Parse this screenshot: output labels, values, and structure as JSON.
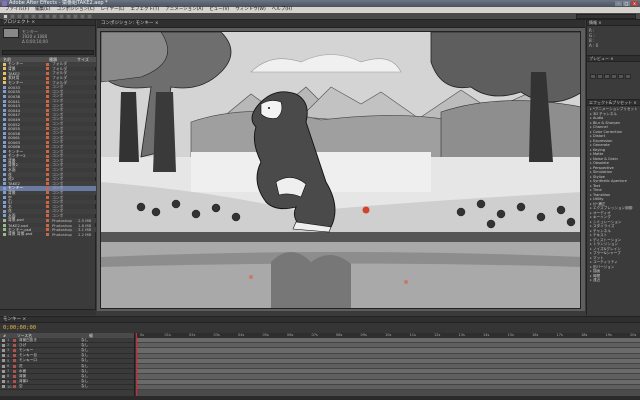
{
  "app": {
    "title": "Adobe After Effects - 猿番組TAKE2.aep *"
  },
  "menu": [
    "ファイル(F)",
    "編集(E)",
    "コンポジション(C)",
    "レイヤー(L)",
    "エフェクト(T)",
    "アニメーション(A)",
    "ビュー(V)",
    "ウィンドウ(W)",
    "ヘルプ(H)"
  ],
  "project_panel": {
    "tab_label": "プロジェクト ×",
    "thumb_info": [
      "モンキー",
      "1920 x 1080",
      "Δ 0;00;10;00"
    ],
    "columns": [
      "名前",
      "種類",
      "サイズ"
    ],
    "items": [
      {
        "name": "モンキー",
        "type": "フォルダ",
        "size": "",
        "kind": "folder"
      },
      {
        "name": "背景",
        "type": "フォルダ",
        "size": "",
        "kind": "folder"
      },
      {
        "name": "TAKE2",
        "type": "フォルダ",
        "size": "",
        "kind": "folder"
      },
      {
        "name": "素材用",
        "type": "フォルダ",
        "size": "",
        "kind": "folder"
      },
      {
        "name": "モンキー",
        "type": "フォルダ",
        "size": "",
        "kind": "folder"
      },
      {
        "name": "00033",
        "type": "コンポ",
        "size": "",
        "kind": "comp"
      },
      {
        "name": "00035",
        "type": "コンポ",
        "size": "",
        "kind": "comp"
      },
      {
        "name": "00038",
        "type": "コンポ",
        "size": "",
        "kind": "comp"
      },
      {
        "name": "00041",
        "type": "コンポ",
        "size": "",
        "kind": "comp"
      },
      {
        "name": "00043",
        "type": "コンポ",
        "size": "",
        "kind": "comp"
      },
      {
        "name": "00044",
        "type": "コンポ",
        "size": "",
        "kind": "comp"
      },
      {
        "name": "00047",
        "type": "コンポ",
        "size": "",
        "kind": "comp"
      },
      {
        "name": "00049",
        "type": "コンポ",
        "size": "",
        "kind": "comp"
      },
      {
        "name": "00052",
        "type": "コンポ",
        "size": "",
        "kind": "comp"
      },
      {
        "name": "00055",
        "type": "コンポ",
        "size": "",
        "kind": "comp"
      },
      {
        "name": "00058",
        "type": "コンポ",
        "size": "",
        "kind": "comp"
      },
      {
        "name": "00061",
        "type": "コンポ",
        "size": "",
        "kind": "comp"
      },
      {
        "name": "00063",
        "type": "コンポ",
        "size": "",
        "kind": "comp"
      },
      {
        "name": "00066",
        "type": "コンポ",
        "size": "",
        "kind": "comp"
      },
      {
        "name": "モンキー",
        "type": "コンポ",
        "size": "",
        "kind": "comp"
      },
      {
        "name": "モンキー2",
        "type": "コンポ",
        "size": "",
        "kind": "comp"
      },
      {
        "name": "背景",
        "type": "コンポ",
        "size": "",
        "kind": "comp"
      },
      {
        "name": "背景2",
        "type": "コンポ",
        "size": "",
        "kind": "comp"
      },
      {
        "name": "水面",
        "type": "コンポ",
        "size": "",
        "kind": "comp"
      },
      {
        "name": "花",
        "type": "コンポ",
        "size": "",
        "kind": "comp"
      },
      {
        "name": "花2",
        "type": "コンポ",
        "size": "",
        "kind": "comp"
      },
      {
        "name": "TAKE2",
        "type": "コンポ",
        "size": "",
        "kind": "comp"
      },
      {
        "name": "モンキー",
        "type": "コンポ",
        "size": "",
        "kind": "comp",
        "selected": true
      },
      {
        "name": "背景",
        "type": "コンポ",
        "size": "",
        "kind": "comp"
      },
      {
        "name": "空",
        "type": "コンポ",
        "size": "",
        "kind": "comp"
      },
      {
        "name": "山",
        "type": "コンポ",
        "size": "",
        "kind": "comp"
      },
      {
        "name": "木",
        "type": "コンポ",
        "size": "",
        "kind": "comp"
      },
      {
        "name": "花",
        "type": "コンポ",
        "size": "",
        "kind": "comp"
      },
      {
        "name": "水面",
        "type": "コンポ",
        "size": "",
        "kind": "comp"
      },
      {
        "name": "背景.psd",
        "type": "Photoshop",
        "size": "2.5 MB",
        "kind": "img"
      },
      {
        "name": "TAKE2.psd",
        "type": "Photoshop",
        "size": "1.8 MB",
        "kind": "img"
      },
      {
        "name": "モンキー.psd",
        "type": "Photoshop",
        "size": "3.1 MB",
        "kind": "img"
      },
      {
        "name": "背景 背景.psd",
        "type": "Photoshop",
        "size": "2.2 MB",
        "kind": "img"
      }
    ]
  },
  "viewer": {
    "tab_label": "コンポジション: モンキー ×"
  },
  "info_panel": {
    "tab_label": "情報 ×",
    "lines": [
      "R :",
      "G :",
      "B :",
      "A : 0"
    ]
  },
  "preview_panel": {
    "tab_label": "プレビュー ×"
  },
  "effects_panel": {
    "tab_label": "エフェクト&プリセット ×",
    "items": [
      "*アニメーションプリセット",
      "3D チャンネル",
      "Audio",
      "Blur & Sharpen",
      "Channel",
      "Color Correction",
      "Distort",
      "Expression",
      "Generate",
      "Keying",
      "Matte",
      "Noise & Grain",
      "Obsolete",
      "Perspective",
      "Simulation",
      "Stylize",
      "Synthetic Aperture",
      "Text",
      "Time",
      "Transition",
      "Utility",
      "ｶﾗｰ補正",
      "エクスプレッション制御",
      "オーディオ",
      "キーイング",
      "シミュレーション",
      "スタイライズ",
      "チャンネル",
      "テキスト",
      "ディストーション",
      "トランジション",
      "ノイズ&グレイン",
      "ブラー&シャープ",
      "マット",
      "ユーティリティ",
      "旧バージョン",
      "描画",
      "時間",
      "遠近"
    ]
  },
  "timeline": {
    "tab_label": "モンキー ×",
    "timecode": "0;00;00;00",
    "columns": [
      "#",
      "ソース名",
      "親"
    ],
    "layers": [
      {
        "num": "1",
        "name": "背景白抜き",
        "parent": "なし"
      },
      {
        "num": "2",
        "name": "ひげ",
        "parent": "なし"
      },
      {
        "num": "3",
        "name": "モンキー",
        "parent": "なし"
      },
      {
        "num": "4",
        "name": "モンキー目",
        "parent": "なし"
      },
      {
        "num": "5",
        "name": "モンキー口",
        "parent": "なし"
      },
      {
        "num": "6",
        "name": "花",
        "parent": "なし"
      },
      {
        "num": "7",
        "name": "水面",
        "parent": "なし"
      },
      {
        "num": "8",
        "name": "背景",
        "parent": "なし"
      },
      {
        "num": "9",
        "name": "背景2",
        "parent": "なし"
      },
      {
        "num": "10",
        "name": "空",
        "parent": "なし"
      }
    ],
    "ruler": [
      "0s",
      "01s",
      "02s",
      "03s",
      "04s",
      "05s",
      "06s",
      "07s",
      "08s",
      "09s",
      "10s",
      "11s",
      "12s",
      "13s",
      "14s",
      "15s",
      "16s",
      "17s",
      "18s",
      "19s",
      "20s"
    ]
  },
  "colors": {
    "accent_timecode": "#e9b84d",
    "playhead": "#dd2233",
    "selection": "#6a7aa0"
  }
}
